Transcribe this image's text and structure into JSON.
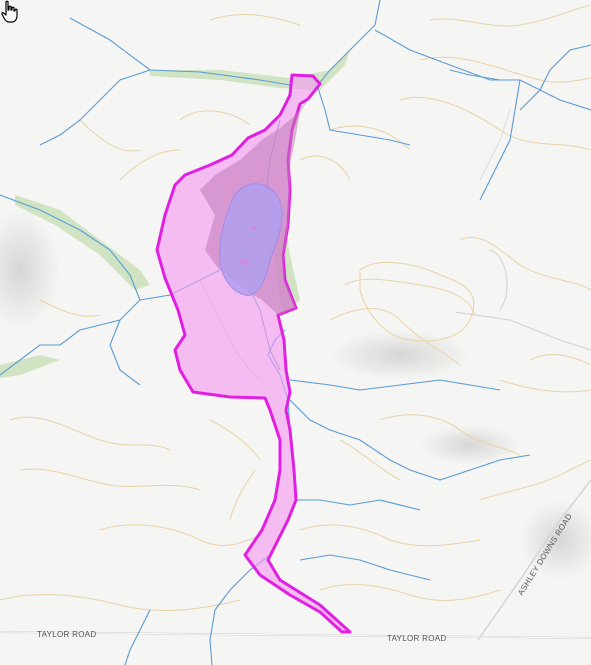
{
  "map": {
    "road_labels": {
      "taylor_road_left": "TAYLOR ROAD",
      "taylor_road_right": "TAYLOR ROAD",
      "ashley_downs_road": "ASHLEY DOWNS ROAD"
    },
    "colors": {
      "background": "#f5f5f3",
      "contour": "#e8d3a8",
      "stream": "#5b9bd5",
      "vegetation": "#b9d9a8",
      "road": "#cfcfcf",
      "boundary_outline": "#e020e0",
      "boundary_fill": "#f0a0f0",
      "water_fill": "#b7a0f0",
      "inner_fill": "#c77ad0"
    },
    "cursor": "hand-pointer-icon"
  }
}
